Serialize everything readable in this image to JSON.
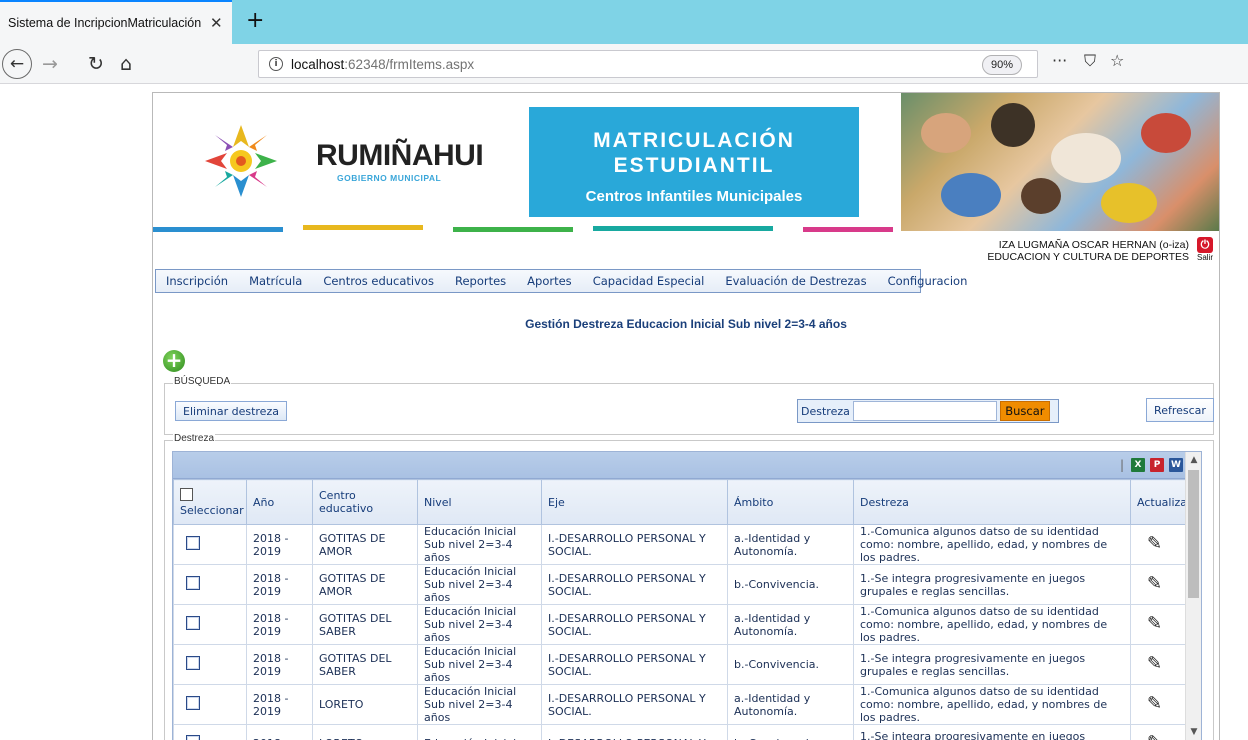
{
  "browser": {
    "tab_title": "Sistema de IncripcionMatriculación",
    "tab_close": "✕",
    "new_tab": "+",
    "url_host": "localhost",
    "url_path": ":62348/frmItems.aspx",
    "zoom": "90%",
    "more_icon": "···",
    "pocket_icon": "⛉",
    "bookmark_icon": "☆"
  },
  "banner": {
    "logo_text": "RUMIÑAHUI",
    "logo_sub": "GOBIERNO MUNICIPAL",
    "hero_line1": "MATRICULACIÓN",
    "hero_line2": "ESTUDIANTIL",
    "hero_line3": "Centros Infantiles Municipales"
  },
  "user": {
    "name": "IZA LUGMAÑA OSCAR HERNAN (o-iza)",
    "department": "EDUCACION Y CULTURA DE DEPORTES",
    "logout_label": "Salir"
  },
  "menu": [
    "Inscripción",
    "Matrícula",
    "Centros educativos",
    "Reportes",
    "Aportes",
    "Capacidad Especial",
    "Evaluación de Destrezas",
    "Configuracion"
  ],
  "page_title": "Gestión Destreza Educacion Inicial Sub nivel 2=3-4 años",
  "search_section": {
    "legend": "BÚSQUEDA",
    "delete_button": "Eliminar destreza",
    "search_label": "Destreza",
    "search_value": "",
    "search_button": "Buscar",
    "refresh_button": "Refrescar"
  },
  "grid": {
    "legend": "Destreza",
    "export_separator": "|",
    "columns": [
      "Seleccionar",
      "Año",
      "Centro educativo",
      "Nivel",
      "Eje",
      "Ámbito",
      "Destreza",
      "Actualizar"
    ],
    "rows": [
      {
        "anio": "2018 - 2019",
        "centro": "GOTITAS DE AMOR",
        "nivel": "Educación Inicial Sub nivel 2=3-4 años",
        "eje": "I.-DESARROLLO PERSONAL Y SOCIAL.",
        "ambito": "a.-Identidad y Autonomía.",
        "destreza": "1.-Comunica algunos datso de su identidad como: nombre, apellido, edad, y nombres de los padres."
      },
      {
        "anio": "2018 - 2019",
        "centro": "GOTITAS DE AMOR",
        "nivel": "Educación Inicial Sub nivel 2=3-4 años",
        "eje": "I.-DESARROLLO PERSONAL Y SOCIAL.",
        "ambito": "b.-Convivencia.",
        "destreza": "1.-Se integra progresivamente en juegos grupales e reglas sencillas."
      },
      {
        "anio": "2018 - 2019",
        "centro": "GOTITAS DEL SABER",
        "nivel": "Educación Inicial Sub nivel 2=3-4 años",
        "eje": "I.-DESARROLLO PERSONAL Y SOCIAL.",
        "ambito": "a.-Identidad y Autonomía.",
        "destreza": "1.-Comunica algunos datso de su identidad como: nombre, apellido, edad, y nombres de los padres."
      },
      {
        "anio": "2018 - 2019",
        "centro": "GOTITAS DEL SABER",
        "nivel": "Educación Inicial Sub nivel 2=3-4 años",
        "eje": "I.-DESARROLLO PERSONAL Y SOCIAL.",
        "ambito": "b.-Convivencia.",
        "destreza": "1.-Se integra progresivamente en juegos grupales e reglas sencillas."
      },
      {
        "anio": "2018 - 2019",
        "centro": "LORETO",
        "nivel": "Educación Inicial Sub nivel 2=3-4 años",
        "eje": "I.-DESARROLLO PERSONAL Y SOCIAL.",
        "ambito": "a.-Identidad y Autonomía.",
        "destreza": "1.-Comunica algunos datso de su identidad como: nombre, apellido, edad, y nombres de los padres."
      },
      {
        "anio": "2018 -",
        "centro": "LORETO",
        "nivel": "Educación Inicial",
        "eje": "I.-DESARROLLO PERSONAL Y",
        "ambito": "b.-Convivencia.",
        "destreza": "1.-Se integra progresivamente en juegos grupales"
      }
    ]
  },
  "colors": {
    "tabbar": "#7fd3e6",
    "hero": "#29a8d9",
    "menu_text": "#163c7a",
    "search_button": "#f08c00",
    "logout": "#d6182a"
  }
}
